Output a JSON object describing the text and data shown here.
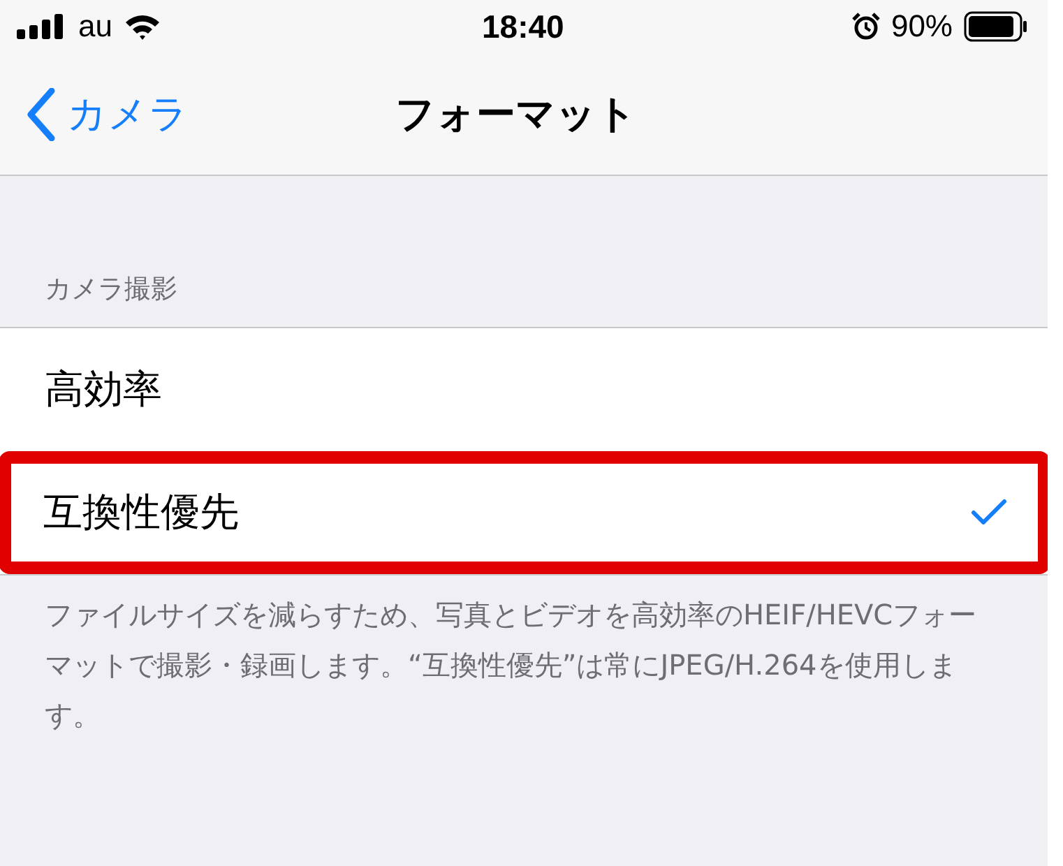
{
  "status_bar": {
    "carrier": "au",
    "time": "18:40",
    "battery": "90%"
  },
  "nav": {
    "back": "カメラ",
    "title": "フォーマット"
  },
  "section": {
    "header": "カメラ撮影",
    "rows": [
      {
        "label": "高効率",
        "selected": false,
        "highlighted": false
      },
      {
        "label": "互換性優先",
        "selected": true,
        "highlighted": true
      }
    ],
    "footer": "ファイルサイズを減らすため、写真とビデオを高効率のHEIF/HEVCフォーマットで撮影・録画します。“互換性優先”は常にJPEG/H.264を使用します。"
  }
}
